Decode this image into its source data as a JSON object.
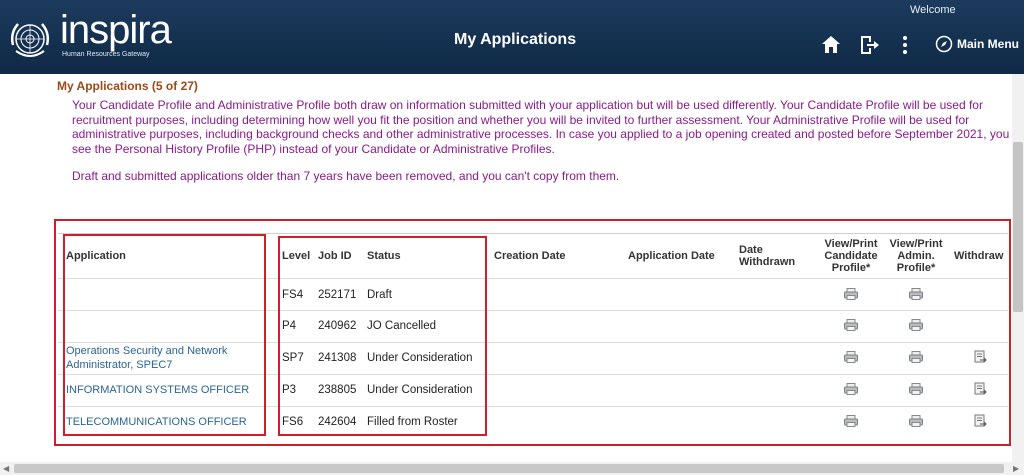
{
  "header": {
    "logo_text": "inspira",
    "logo_subtitle": "Human Resources Gateway",
    "welcome": "Welcome",
    "page_title": "My Applications",
    "main_menu_label": "Main Menu"
  },
  "intro": {
    "title": "My Applications (5 of 27)",
    "paragraph": "Your Candidate Profile and Administrative Profile both draw on information submitted with your application but will be used differently. Your Candidate Profile will be used for recruitment purposes, including determining how well you fit the position and whether you will be invited to further assessment. Your Administrative Profile will be used for administrative purposes, including background checks and other administrative processes. In case you applied to a job opening created and posted before September 2021, you see the Personal History Profile (PHP) instead of your Candidate or Administrative Profiles.",
    "note": "Draft and submitted applications older than 7 years have been removed, and you can't copy from them."
  },
  "table": {
    "headers": {
      "application": "Application",
      "level": "Level",
      "job_id": "Job ID",
      "status": "Status",
      "creation_date": "Creation Date",
      "application_date": "Application Date",
      "date_withdrawn_1": "Date",
      "date_withdrawn_2": "Withdrawn",
      "cand_1": "View/Print",
      "cand_2": "Candidate",
      "cand_3": "Profile*",
      "admin_1": "View/Print",
      "admin_2": "Admin.",
      "admin_3": "Profile*",
      "withdraw": "Withdraw"
    },
    "rows": [
      {
        "application_1": "",
        "application_2": "",
        "level": "FS4",
        "job_id": "252171",
        "status": "Draft"
      },
      {
        "application_1": "",
        "application_2": "",
        "level": "P4",
        "job_id": "240962",
        "status": "JO Cancelled"
      },
      {
        "application_1": "Operations Security and Network",
        "application_2": "Administrator, SPEC7",
        "level": "SP7",
        "job_id": "241308",
        "status": "Under Consideration"
      },
      {
        "application_1": "INFORMATION SYSTEMS OFFICER",
        "application_2": "",
        "level": "P3",
        "job_id": "238805",
        "status": "Under Consideration"
      },
      {
        "application_1": "TELECOMMUNICATIONS OFFICER",
        "application_2": "",
        "level": "FS6",
        "job_id": "242604",
        "status": "Filled from Roster"
      }
    ]
  },
  "colors": {
    "header_bg": "#14304f",
    "title_brown": "#9a4a18",
    "intro_purple": "#8a1a8a",
    "link_blue": "#2a6496",
    "highlight_red": "#cf1f2a"
  },
  "icons": {
    "logo": "un-emblem-icon",
    "home": "home-icon",
    "logout": "logout-icon",
    "more": "vertical-ellipsis-icon",
    "main_menu": "compass-icon",
    "print": "printer-icon",
    "withdraw": "withdraw-icon"
  }
}
